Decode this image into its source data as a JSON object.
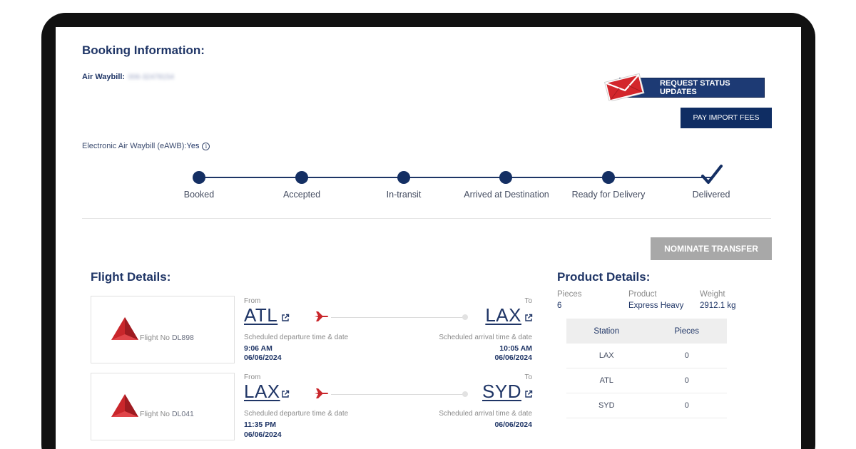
{
  "booking": {
    "title": "Booking Information:",
    "awb_label": "Air Waybill:",
    "awb_value": "006-32478154",
    "eawb_label": "Electronic Air Waybill (eAWB):",
    "eawb_value": "Yes",
    "info_glyph": "i"
  },
  "actions": {
    "request_status": "REQUEST STATUS UPDATES",
    "pay_import": "PAY IMPORT FEES",
    "nominate": "NOMINATE TRANSFER"
  },
  "tracking": {
    "steps": [
      "Booked",
      "Accepted",
      "In-transit",
      "Arrived at Destination",
      "Ready for Delivery",
      "Delivered"
    ],
    "completed_step": "Delivered"
  },
  "flight_details": {
    "title": "Flight Details:",
    "flights": [
      {
        "flight_no_label": "Flight No",
        "flight_no": "DL898",
        "from_label": "From",
        "to_label": "To",
        "from": "ATL",
        "to": "LAX",
        "dep_label": "Scheduled departure time & date",
        "arr_label": "Scheduled arrival time & date",
        "dep_time": "9:06 AM",
        "dep_date": "06/06/2024",
        "arr_time": "10:05 AM",
        "arr_date": "06/06/2024"
      },
      {
        "flight_no_label": "Flight No",
        "flight_no": "DL041",
        "from_label": "From",
        "to_label": "To",
        "from": "LAX",
        "to": "SYD",
        "dep_label": "Scheduled departure time & date",
        "arr_label": "Scheduled arrival time & date",
        "dep_time": "11:35 PM",
        "dep_date": "06/06/2024",
        "arr_time": "",
        "arr_date": "06/06/2024"
      }
    ]
  },
  "product_details": {
    "title": "Product Details:",
    "pieces_label": "Pieces",
    "pieces": "6",
    "product_label": "Product",
    "product": "Express Heavy",
    "weight_label": "Weight",
    "weight": "2912.1 kg",
    "table": {
      "headers": [
        "Station",
        "Pieces"
      ],
      "rows": [
        [
          "LAX",
          "0"
        ],
        [
          "ATL",
          "0"
        ],
        [
          "SYD",
          "0"
        ]
      ]
    }
  },
  "colors": {
    "primary": "#0f2d63",
    "accent_red": "#c9262b",
    "disabled": "#a8a8a8"
  },
  "icons": {
    "envelope": "envelope-icon",
    "info": "info-icon",
    "check": "checkmark-icon",
    "plane": "airplane-icon",
    "external": "external-link-icon",
    "logo": "delta-logo"
  }
}
